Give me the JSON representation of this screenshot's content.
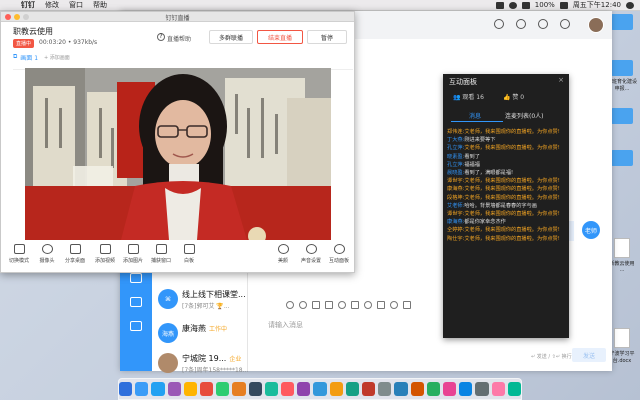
{
  "menubar": {
    "app": "钉钉",
    "items": [
      "修改",
      "窗口",
      "帮助"
    ],
    "battery": "100%",
    "clock": "周五下午12:40"
  },
  "live": {
    "window_title": "钉钉直播",
    "course_name": "职教云使用",
    "live_badge": "直播中",
    "stats": "00:03:20  •  937kb/s",
    "help": "直播帮助",
    "help_icon_text": "?",
    "btn_multi": "多群联播",
    "btn_end": "结束直播",
    "btn_pause": "暂停",
    "tab_name": "画面 1",
    "add_scene": "+ 添加画面",
    "toolbar": [
      {
        "label": "切换模式",
        "icon": "layout-grid-icon"
      },
      {
        "label": "摄像头",
        "icon": "camera-icon"
      },
      {
        "label": "分享桌面",
        "icon": "share-desktop-icon"
      },
      {
        "label": "添加视频",
        "icon": "video-icon"
      },
      {
        "label": "添加图片",
        "icon": "image-icon"
      },
      {
        "label": "捕获窗口",
        "icon": "window-icon"
      },
      {
        "label": "白板",
        "icon": "whiteboard-icon"
      }
    ],
    "toolbar_right": [
      {
        "label": "美颜",
        "icon": "beauty-icon"
      },
      {
        "label": "声音设置",
        "icon": "mic-icon"
      },
      {
        "label": "互动面板",
        "icon": "chat-icon"
      }
    ]
  },
  "panel": {
    "title": "互动面板",
    "close": "×",
    "watch_label": "观看 16",
    "like_label": "赞 0",
    "tab_msg": "消息",
    "tab_mic": "连麦列表(0人)",
    "messages": [
      {
        "user": "郑伟连:",
        "text": "艾老师，我来围观你的直播啦。为你点赞!",
        "uc": "o",
        "tc": ""
      },
      {
        "user": "丁大燕:",
        "text": "刚进来要等下",
        "uc": "",
        "tc": "w"
      },
      {
        "user": "孔立萍:",
        "text": "艾老师，我来围观你的直播啦。为你点赞!",
        "uc": "",
        "tc": ""
      },
      {
        "user": "晓素盈:",
        "text": "看到了",
        "uc": "",
        "tc": "w"
      },
      {
        "user": "孔立萍:",
        "text": "福福福",
        "uc": "",
        "tc": "w"
      },
      {
        "user": "晨晓盈:",
        "text": "看到了，满眼都是福!",
        "uc": "",
        "tc": "w"
      },
      {
        "user": "谭世宇:",
        "text": "艾老师，我来围观你的直播啦。为你点赞!",
        "uc": "o",
        "tc": ""
      },
      {
        "user": "康海燕:",
        "text": "艾老师，我来围观你的直播啦。为你点赞!",
        "uc": "o",
        "tc": ""
      },
      {
        "user": "段格坤:",
        "text": "艾老师，我来围观你的直播啦。为你点赞!",
        "uc": "o",
        "tc": ""
      },
      {
        "user": "艾老师:",
        "text": "哈哈。背景墙都是春春的字与画",
        "uc": "",
        "tc": "w"
      },
      {
        "user": "谭世宇:",
        "text": "艾老师，我来围观你的直播啦。为你点赞!",
        "uc": "o",
        "tc": ""
      },
      {
        "user": "康海燕:",
        "text": "都是你家幸念杰作",
        "uc": "",
        "tc": "w"
      },
      {
        "user": "仝婷婷:",
        "text": "艾老师，我来围观你的直播啦。为你点赞!",
        "uc": "o",
        "tc": ""
      },
      {
        "user": "陶仕宇:",
        "text": "艾老师，我来围观你的直播啦。为你点赞!",
        "uc": "o",
        "tc": ""
      }
    ]
  },
  "chat": {
    "conversations": [
      {
        "name": "线上线下相课堂...",
        "sub": "[7条]郭可艾 🏆...",
        "avatar": "",
        "tag": "",
        "time": ""
      },
      {
        "name": "康海燕",
        "sub": "",
        "avatar": "海燕",
        "tag": "工作中",
        "time": ""
      },
      {
        "name": "宁城院 19...",
        "sub": "[7条]周年158*****18...",
        "avatar": "",
        "tag": "企业",
        "time": ""
      }
    ],
    "input_placeholder": "请输入消息",
    "send_hint": "↵ 发送 / ⇧↵ 换行",
    "send": "发送",
    "bubble": "老师",
    "bubble_left": "群"
  },
  "desktop": [
    {
      "label": "",
      "kind": "f"
    },
    {
      "label": "网班育化建设\n申报...",
      "kind": "f"
    },
    {
      "label": "",
      "kind": "f"
    },
    {
      "label": "",
      "kind": "f"
    },
    {
      "label": "新教云使用\n...",
      "kind": "d"
    },
    {
      "label": "宁波学习平\n台.docx",
      "kind": "d"
    }
  ],
  "dock_colors": [
    "#2f6fdc",
    "#3b9cf7",
    "#23a1f2",
    "#9b59b6",
    "#ffb400",
    "#e74c3c",
    "#2ecc71",
    "#e67e22",
    "#34495e",
    "#1abc9c",
    "#ff5a5f",
    "#8e44ad",
    "#3498db",
    "#f39c12",
    "#16a085",
    "#c0392b",
    "#7f8c8d",
    "#2980b9",
    "#d35400",
    "#27ae60",
    "#e84393",
    "#0984e3",
    "#636e72",
    "#fd79a8",
    "#00b894"
  ]
}
